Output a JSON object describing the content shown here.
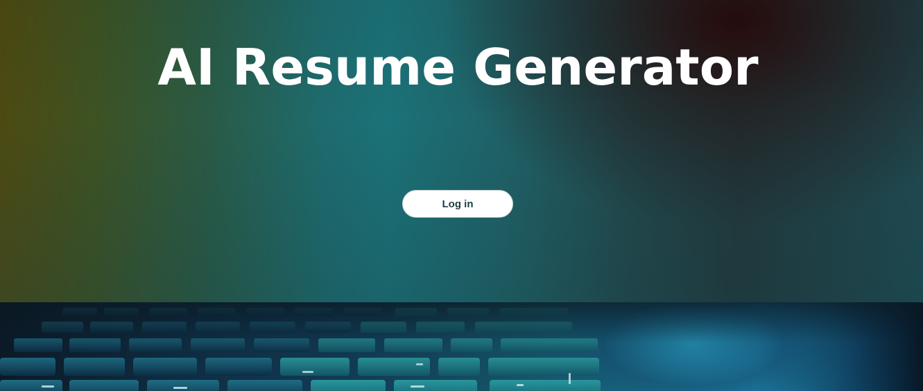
{
  "hero": {
    "title": "AI Resume Generator",
    "login_label": "Log in"
  },
  "keyboard_image": {
    "icon": "laptop-keyboard-photo"
  }
}
